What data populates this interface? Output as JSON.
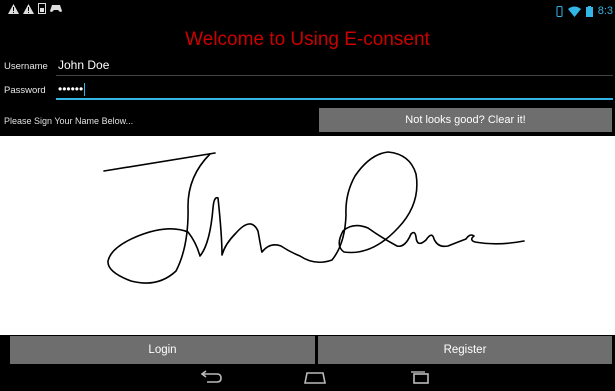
{
  "status": {
    "time": "8:3"
  },
  "app": {
    "title": "Welcome to Using E-consent"
  },
  "form": {
    "username_label": "Username",
    "username_value": "John Doe",
    "password_label": "Password",
    "password_value": "••••••"
  },
  "signature": {
    "prompt": "Please Sign Your Name Below...",
    "clear_label": "Not looks good? Clear it!"
  },
  "actions": {
    "login_label": "Login",
    "register_label": "Register"
  },
  "colors": {
    "title": "#cc0000",
    "accent": "#33b5e5",
    "button": "#6e6e6e"
  },
  "icons": [
    "warning-icon",
    "warning-icon",
    "sim-icon",
    "game-controller-icon",
    "vibrate-icon",
    "wifi-icon",
    "battery-icon",
    "back-icon",
    "home-icon",
    "recent-apps-icon"
  ]
}
